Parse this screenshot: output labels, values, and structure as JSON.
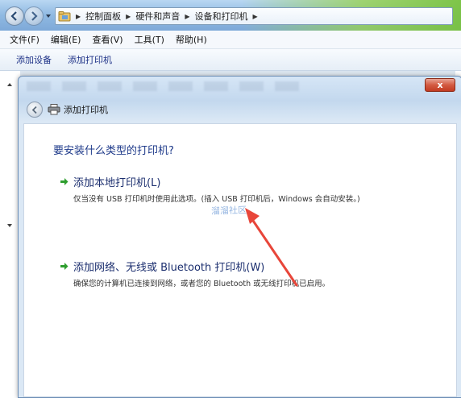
{
  "explorer": {
    "breadcrumbs": [
      "控制面板",
      "硬件和声音",
      "设备和打印机"
    ],
    "menu": [
      "文件(F)",
      "编辑(E)",
      "查看(V)",
      "工具(T)",
      "帮助(H)"
    ],
    "commands": [
      "添加设备",
      "添加打印机"
    ]
  },
  "dialog": {
    "close_label": "x",
    "title": "添加打印机",
    "question": "要安装什么类型的打印机?",
    "options": [
      {
        "title": "添加本地打印机(L)",
        "description": "仅当没有 USB 打印机时使用此选项。(插入 USB 打印机后，Windows 会自动安装。)"
      },
      {
        "title": "添加网络、无线或 Bluetooth 打印机(W)",
        "description": "确保您的计算机已连接到网络，或者您的 Bluetooth 或无线打印机已启用。"
      }
    ],
    "watermark": "溜溜社区"
  },
  "colors": {
    "accent_green": "#2e9e2e",
    "annotation_red": "#e8463a",
    "close_red": "#c23b22",
    "link_blue": "#1c2f6f"
  },
  "icons": [
    "back-icon",
    "forward-icon",
    "folder-icon",
    "printer-icon",
    "green-arrow-icon",
    "close-icon"
  ]
}
